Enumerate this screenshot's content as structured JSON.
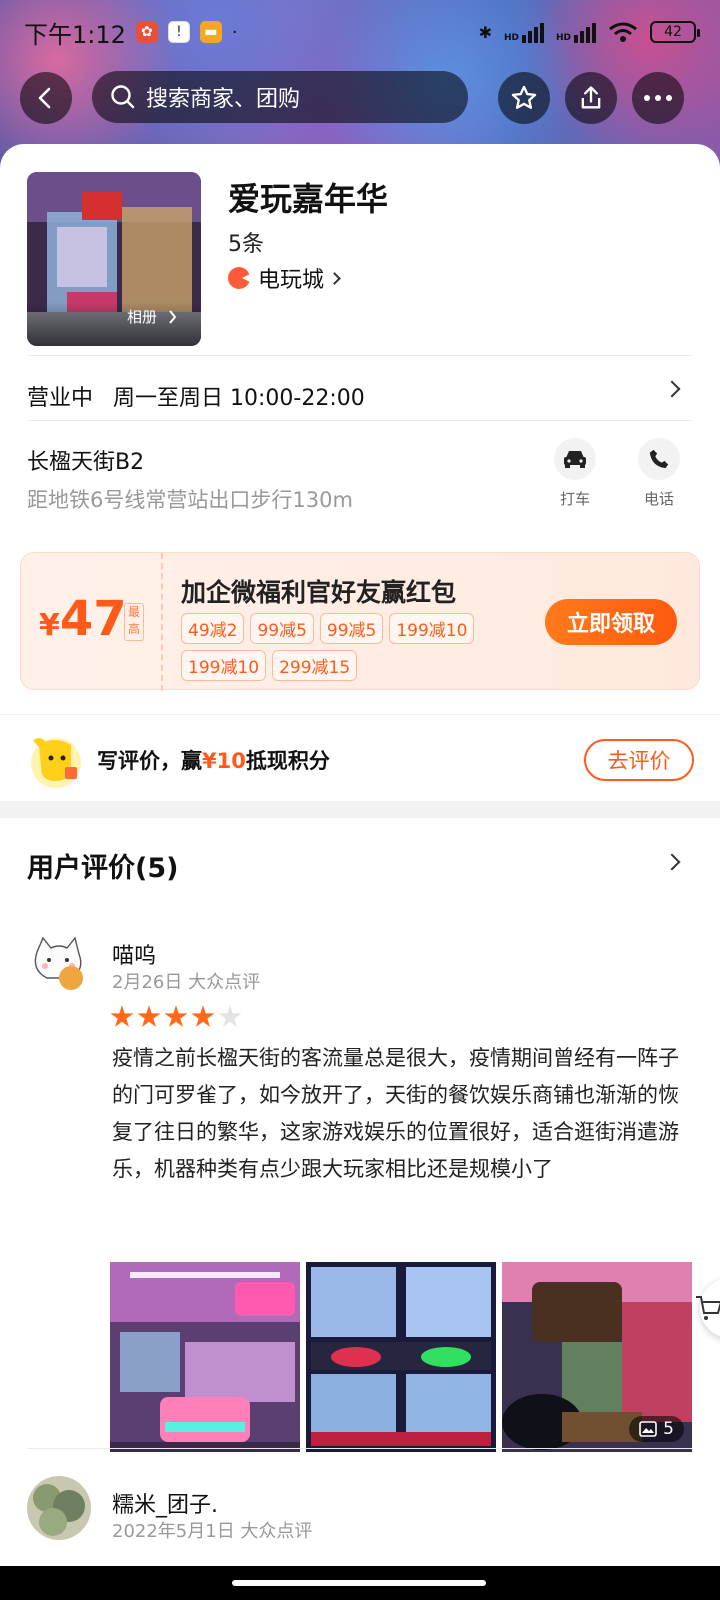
{
  "status_bar": {
    "time": "下午1:12",
    "battery": "42",
    "hd1": "HD",
    "hd2": "HD"
  },
  "nav": {
    "search_placeholder": "搜索商家、团购",
    "icons": [
      "back-icon",
      "search-icon",
      "star-icon",
      "share-icon",
      "more-icon"
    ]
  },
  "shop": {
    "name": "爱玩嘉年华",
    "review_count": "5条",
    "category": "电玩城",
    "album_label": "相册",
    "status": "营业中",
    "hours": "周一至周日 10:00-22:00",
    "address": "长楹天街B2",
    "distance": "距地铁6号线常营站出口步行130m",
    "actions": {
      "taxi": "打车",
      "phone": "电话"
    }
  },
  "coupon": {
    "currency": "¥",
    "amount": "47",
    "max_label": "最高",
    "title": "加企微福利官好友赢红包",
    "chips": [
      "49减2",
      "99减5",
      "99减5",
      "199减10",
      "199减10",
      "299减15"
    ],
    "claim_label": "立即领取",
    "accent": "#ff5a1a"
  },
  "review_prompt": {
    "text_before": "写评价，赢",
    "highlight": "¥10",
    "text_after": "抵现积分",
    "button": "去评价"
  },
  "reviews": {
    "title": "用户评价(5)",
    "items": [
      {
        "user": "喵呜",
        "meta": "2月26日 大众点评",
        "rating": 4,
        "text": "疫情之前长楹天街的客流量总是很大，疫情期间曾经有一阵子的门可罗雀了，如今放开了，天街的餐饮娱乐商铺也渐渐的恢复了往日的繁华，这家游戏娱乐的位置很好，适合逛街消遣游乐，机器种类有点少跟大玩家相比还是规模小了",
        "photo_count": "5"
      },
      {
        "user": "糯米_团子.",
        "meta": "2022年5月1日 大众点评"
      }
    ]
  }
}
